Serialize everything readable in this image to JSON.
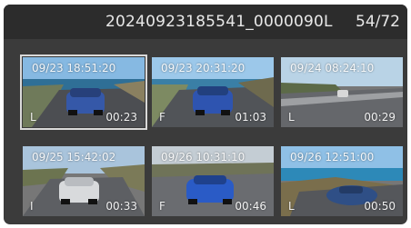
{
  "header": {
    "title": "20240923185541_0000090L",
    "counter": "54/72"
  },
  "thumbnails": [
    {
      "timestamp": "09/23  18:51:20",
      "mode": "L",
      "duration": "00:23",
      "selected": true
    },
    {
      "timestamp": "09/23  20:31:20",
      "mode": "F",
      "duration": "01:03"
    },
    {
      "timestamp": "09/24  08:24:10",
      "mode": "L",
      "duration": "00:29"
    },
    {
      "timestamp": "09/25  15:42:02",
      "mode": "I",
      "duration": "00:33"
    },
    {
      "timestamp": "09/26  10:31:10",
      "mode": "F",
      "duration": "00:46"
    },
    {
      "timestamp": "09/26  12:51:00",
      "mode": "L",
      "duration": "00:50"
    }
  ]
}
